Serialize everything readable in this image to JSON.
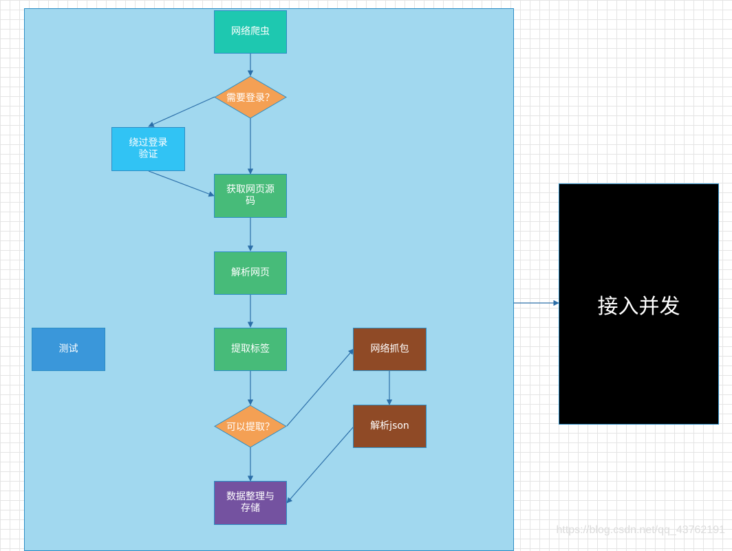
{
  "nodes": {
    "crawler": "网络爬虫",
    "need_login": "需要登录？",
    "bypass_login": "绕过登录\n验证",
    "get_source": "获取网页源\n码",
    "parse_page": "解析网页",
    "extract_tags": "提取标签",
    "can_extract": "可以提取？",
    "packet_capture": "网络抓包",
    "parse_json": "解析json",
    "store_data": "数据整理与\n存储",
    "test": "测试",
    "concurrency": "接入并发"
  },
  "watermark": "https://blog.csdn.net/qq_43762191",
  "colors": {
    "container": "#a1d8ef",
    "teal": "#1ec8b0",
    "orange": "#f4a054",
    "cyan": "#31c3f4",
    "green": "#47bb79",
    "blue": "#3a97da",
    "brown": "#8f4a26",
    "purple": "#7452a0",
    "edge": "#2b6ea8"
  }
}
